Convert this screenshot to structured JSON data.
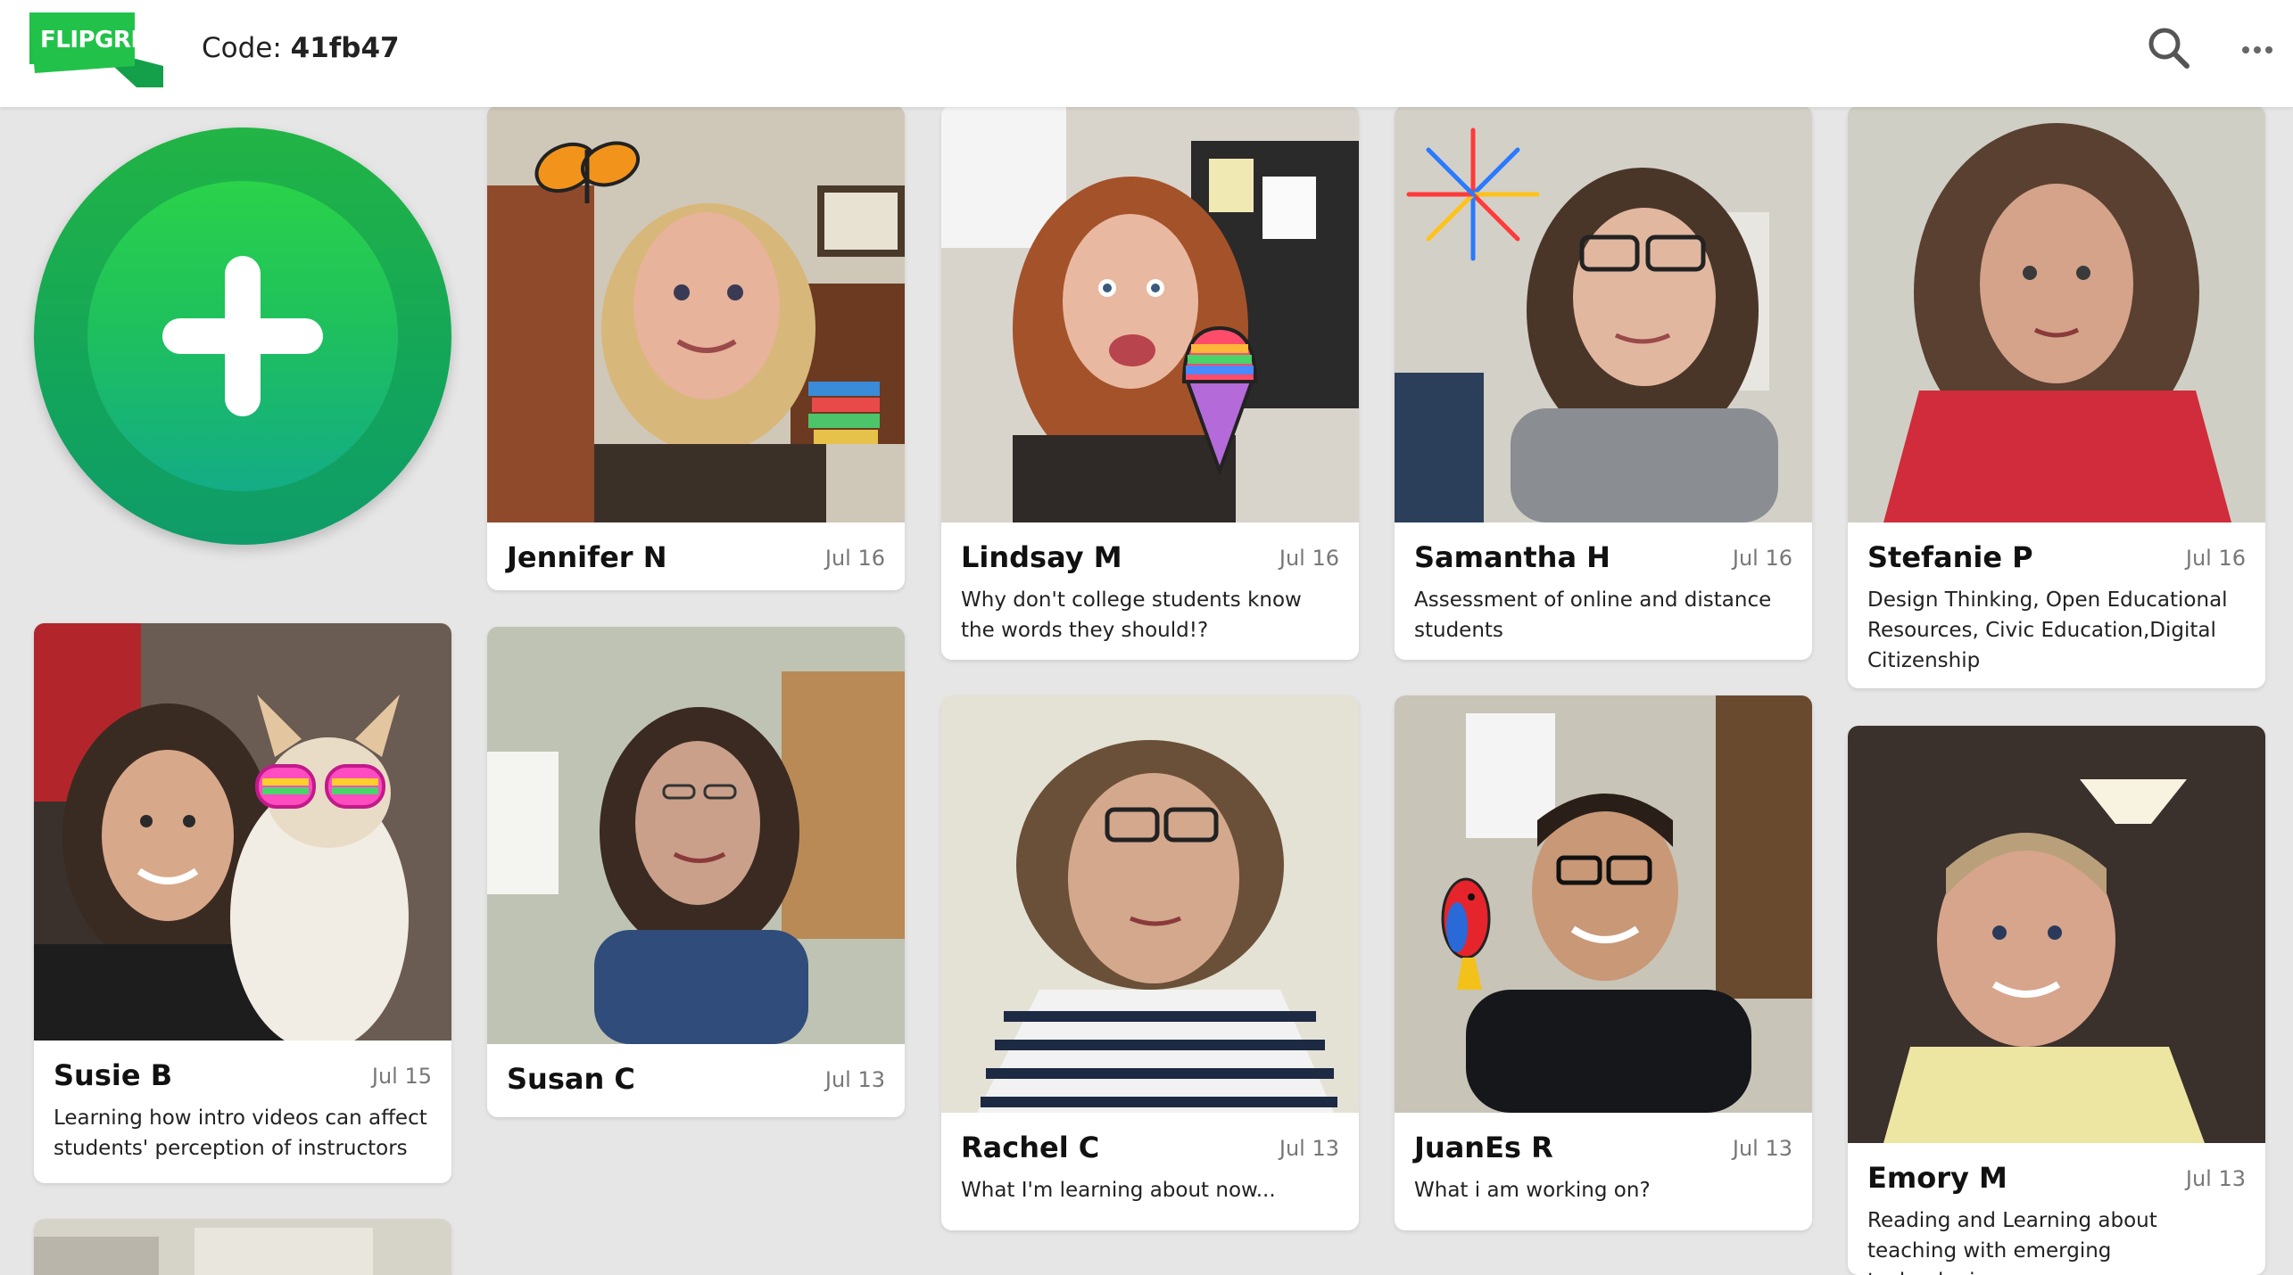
{
  "header": {
    "logo_text": "FLIPGRID",
    "code_label": "Code:",
    "code_value": "41fb47",
    "icons": [
      "search-icon",
      "more-icon"
    ]
  },
  "colors": {
    "brand_green": "#1fbf45",
    "record_outer": "#13a55a",
    "record_inner": "#1fc15c",
    "background": "#e6e6e6"
  },
  "record_button": {
    "icon": "plus-icon"
  },
  "responses": [
    {
      "name": "Jennifer N",
      "date": "Jul 16",
      "desc": "",
      "sticker": "butterfly"
    },
    {
      "name": "Lindsay M",
      "date": "Jul 16",
      "desc": "Why don't college students know the words they should!?",
      "sticker": "snow-cone"
    },
    {
      "name": "Samantha H",
      "date": "Jul 16",
      "desc": "Assessment of online and distance students",
      "sticker": "fireworks"
    },
    {
      "name": "Stefanie P",
      "date": "Jul 16",
      "desc": "Design Thinking, Open Educational Resources, Civic Education,Digital Citizenship",
      "sticker": ""
    },
    {
      "name": "Susie B",
      "date": "Jul 15",
      "desc": "Learning how intro videos can affect students' perception of instructors",
      "sticker": "rainbow-glasses"
    },
    {
      "name": "Susan C",
      "date": "Jul 13",
      "desc": "",
      "sticker": ""
    },
    {
      "name": "Rachel C",
      "date": "Jul 13",
      "desc": "What I'm learning about now...",
      "sticker": ""
    },
    {
      "name": "JuanEs R",
      "date": "Jul 13",
      "desc": "What i am working on?",
      "sticker": "parrot"
    },
    {
      "name": "Emory M",
      "date": "Jul 13",
      "desc": "Reading and Learning about teaching with emerging technologies",
      "sticker": ""
    }
  ]
}
